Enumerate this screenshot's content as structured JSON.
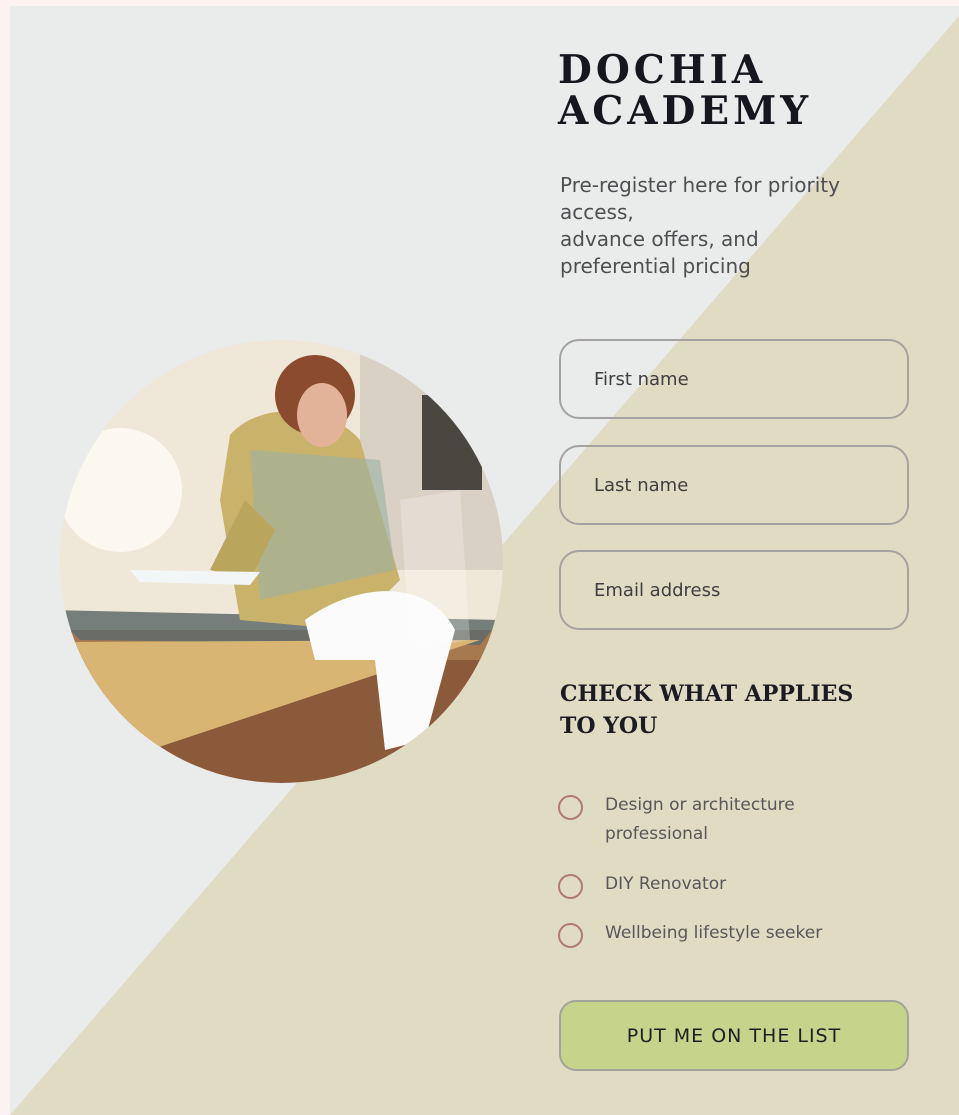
{
  "brand": {
    "line1": "DOCHIA",
    "line2": "ACADEMY"
  },
  "intro": {
    "line1": "Pre-register here for priority",
    "line2": "access,",
    "line3": "advance offers, and",
    "line4": "preferential pricing"
  },
  "form": {
    "first_name_placeholder": "First name",
    "last_name_placeholder": "Last name",
    "email_placeholder": "Email address"
  },
  "checklist": {
    "heading_line1": "CHECK WHAT APPLIES",
    "heading_line2": "TO YOU",
    "options": [
      {
        "label": "Design or architecture professional",
        "selected": false
      },
      {
        "label": "DIY Renovator",
        "selected": false
      },
      {
        "label": "Wellbeing lifestyle seeker",
        "selected": false
      }
    ]
  },
  "submit_label": "PUT ME ON THE LIST",
  "colors": {
    "background_light": "#eaebeb",
    "background_beige": "#e0dbc3",
    "button_green": "#c6d38a",
    "radio_border": "#b07b76"
  },
  "icons": [
    "radio-unchecked-icon"
  ]
}
